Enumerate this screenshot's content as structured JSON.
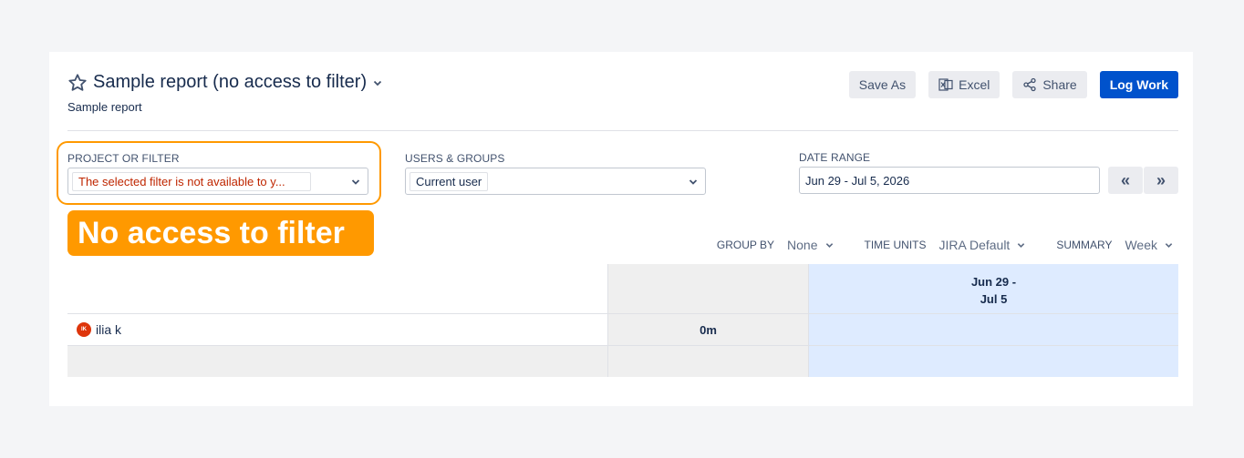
{
  "header": {
    "title": "Sample report (no access to filter)",
    "subtitle": "Sample report"
  },
  "actions": {
    "save_as": "Save As",
    "excel": "Excel",
    "share": "Share",
    "log_work": "Log Work"
  },
  "filters": {
    "project_label": "PROJECT OR FILTER",
    "project_value": "The selected filter is not available to y...",
    "users_label": "USERS & GROUPS",
    "users_value": "Current user",
    "date_label": "DATE RANGE",
    "date_value": "Jun 29 - Jul 5, 2026",
    "prev_label": "«",
    "next_label": "»"
  },
  "callout": "No access to filter",
  "options": {
    "group_by_label": "GROUP BY",
    "group_by_value": "None",
    "time_units_label": "TIME UNITS",
    "time_units_value": "JIRA Default",
    "summary_label": "SUMMARY",
    "summary_value": "Week"
  },
  "grid": {
    "week_line1": "Jun 29 -",
    "week_line2": "Jul 5",
    "rows": [
      {
        "avatar": "IK",
        "name": "ilia k",
        "total": "0m"
      }
    ]
  },
  "colors": {
    "accent": "#0052cc",
    "callout": "#ff9900",
    "error": "#bf2600",
    "week_column": "#deebff"
  }
}
